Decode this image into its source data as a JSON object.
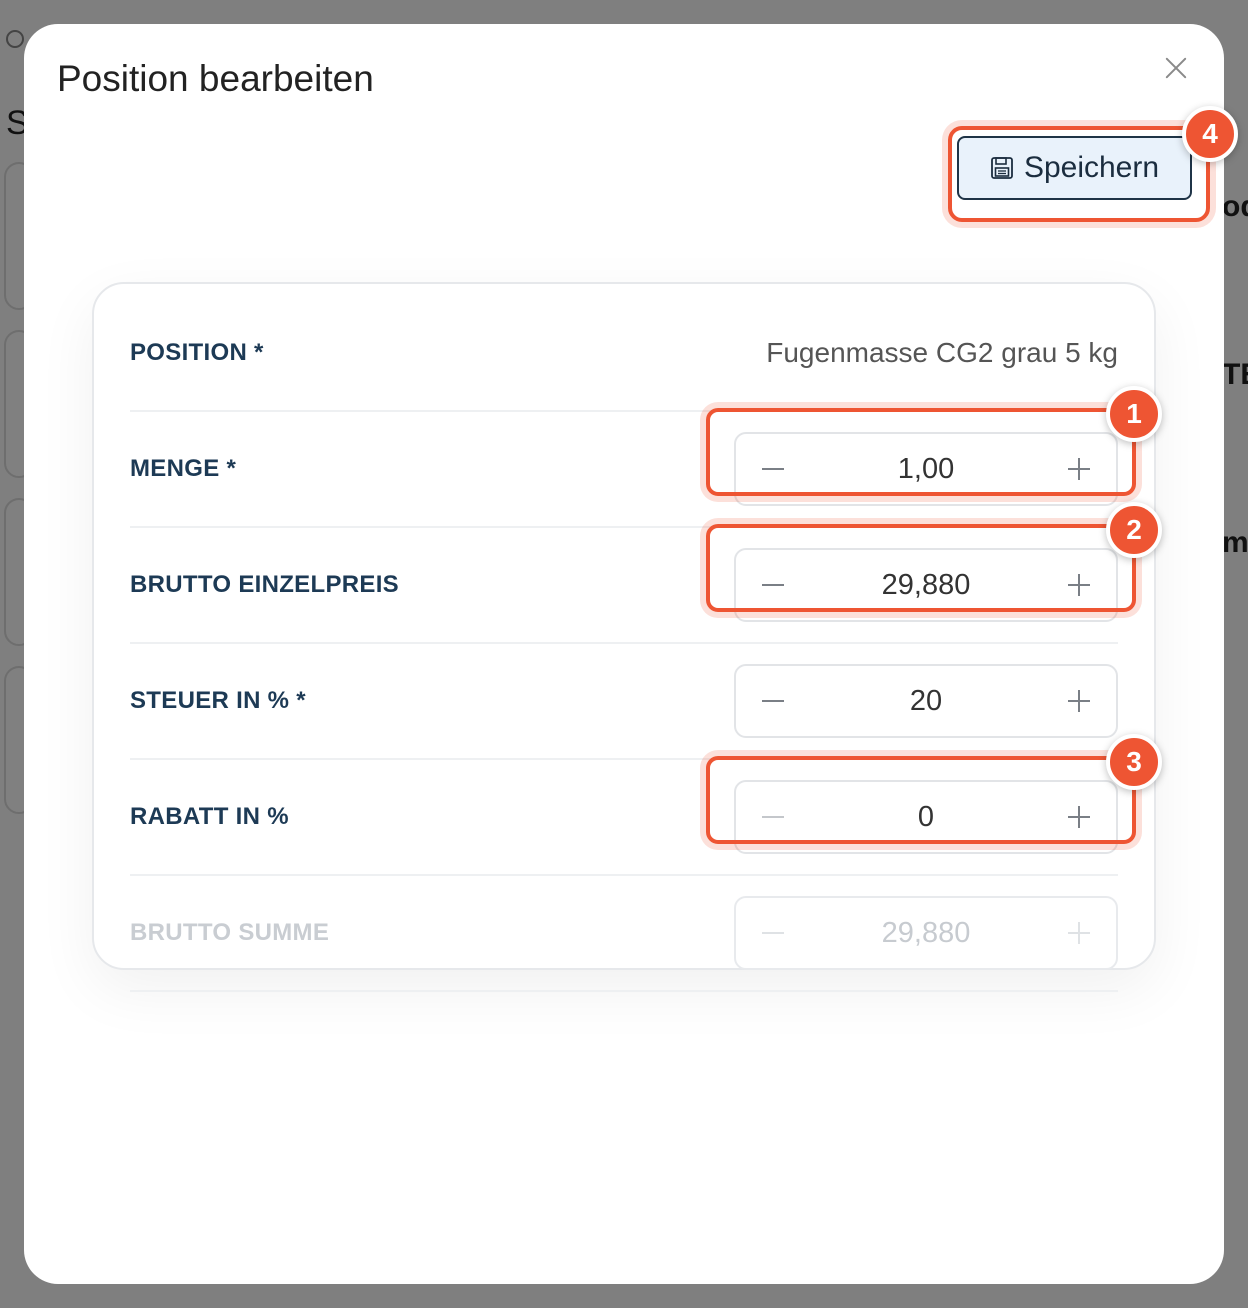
{
  "background": {
    "fragments": [
      "S",
      "od",
      "TE",
      "ma"
    ]
  },
  "modal": {
    "title": "Position bearbeiten",
    "close_label": "close",
    "save_label": "Speichern"
  },
  "form": {
    "position": {
      "label": "POSITION *",
      "value": "Fugenmasse CG2 grau 5 kg"
    },
    "menge": {
      "label": "MENGE *",
      "value": "1,00"
    },
    "brutto_einzelpreis": {
      "label": "BRUTTO EINZELPREIS",
      "value": "29,880"
    },
    "steuer": {
      "label": "STEUER IN % *",
      "value": "20"
    },
    "rabatt": {
      "label": "RABATT IN %",
      "value": "0"
    },
    "brutto_summe": {
      "label": "BRUTTO SUMME",
      "value": "29,880"
    }
  },
  "badges": [
    "1",
    "2",
    "3",
    "4"
  ],
  "colors": {
    "accent": "#ee5533",
    "label": "#1d3a55",
    "save_bg": "#e9f2fb"
  }
}
